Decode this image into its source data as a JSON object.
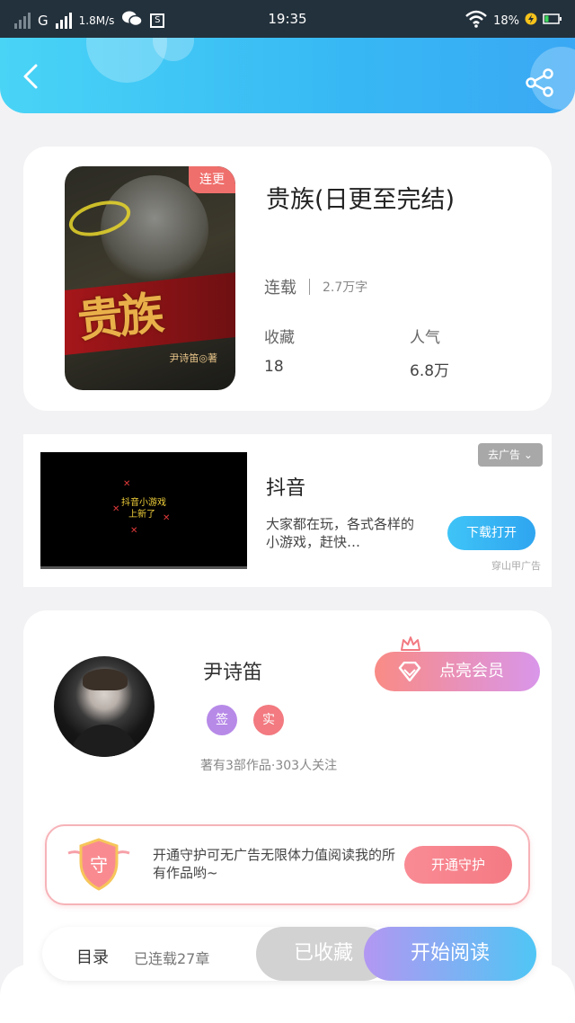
{
  "status_bar": {
    "network": "G",
    "speed": "1.8M/s",
    "time": "19:35",
    "battery": "18%"
  },
  "header": {
    "back_icon": "back-arrow-icon",
    "share_icon": "share-icon"
  },
  "book": {
    "cover_title": "贵族",
    "cover_author": "尹诗笛◎著",
    "cover_tag": "连更",
    "title": "贵族(日更至完结)",
    "status": "连载",
    "word_count": "2.7万字",
    "favorites_label": "收藏",
    "favorites_value": "18",
    "popularity_label": "人气",
    "popularity_value": "6.8万"
  },
  "ad": {
    "close_label": "去广告",
    "video_text_1": "抖音小游戏",
    "video_text_2": "上新了",
    "name": "抖音",
    "description": "大家都在玩，各式各样的小游戏，赶快…",
    "button_label": "下载打开",
    "source": "穿山甲广告"
  },
  "author": {
    "name": "尹诗笛",
    "badge_sign": "签",
    "badge_real": "实",
    "info": "著有3部作品·303人关注",
    "vip_button": "点亮会员",
    "guard_shield_char": "守",
    "guard_text": "开通守护可无广告无限体力值阅读我的所有作品哟~",
    "guard_button": "开通守护"
  },
  "bottom_bar": {
    "toc_label": "目录",
    "chapter_count": "已连载27章",
    "favorite_button": "已收藏",
    "read_button": "开始阅读"
  },
  "colors": {
    "header_start": "#49d4f6",
    "header_end": "#3aa8f4",
    "accent_pink": "#f47a83",
    "read_gradient_start": "#b397f2",
    "read_gradient_end": "#4fc6f5"
  }
}
